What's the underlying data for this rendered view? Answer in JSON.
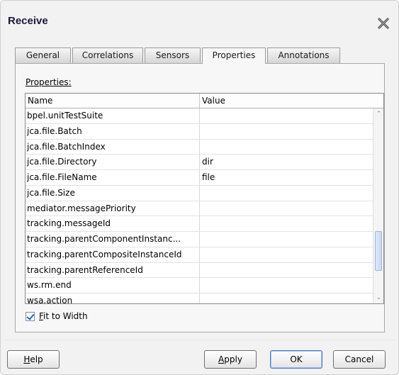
{
  "dialog": {
    "title": "Receive"
  },
  "tabs": [
    {
      "label": "General"
    },
    {
      "label": "Correlations"
    },
    {
      "label": "Sensors"
    },
    {
      "label": "Properties",
      "active": true
    },
    {
      "label": "Annotations"
    }
  ],
  "properties": {
    "label": "Properties:",
    "columns": {
      "name": "Name",
      "value": "Value"
    },
    "rows": [
      {
        "name": "bpel.unitTestSuite",
        "value": ""
      },
      {
        "name": "jca.file.Batch",
        "value": ""
      },
      {
        "name": "jca.file.BatchIndex",
        "value": ""
      },
      {
        "name": "jca.file.Directory",
        "value": "dir"
      },
      {
        "name": "jca.file.FileName",
        "value": "file"
      },
      {
        "name": "jca.file.Size",
        "value": ""
      },
      {
        "name": "mediator.messagePriority",
        "value": ""
      },
      {
        "name": "tracking.messageId",
        "value": ""
      },
      {
        "name": "tracking.parentComponentInstanc...",
        "value": ""
      },
      {
        "name": "tracking.parentCompositeInstanceId",
        "value": ""
      },
      {
        "name": "tracking.parentReferenceId",
        "value": ""
      },
      {
        "name": "ws.rm.end",
        "value": ""
      },
      {
        "name": "wsa.action",
        "value": ""
      }
    ]
  },
  "fit_to_width": {
    "label": "Fit to Width",
    "checked": true
  },
  "buttons": {
    "help": "Help",
    "apply": "Apply",
    "ok": "OK",
    "cancel": "Cancel"
  }
}
